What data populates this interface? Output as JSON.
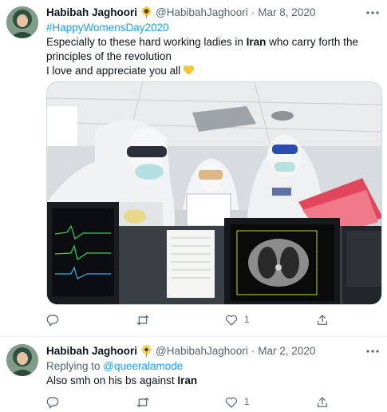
{
  "tweets": [
    {
      "author_name": "Habibah Jaghoori",
      "flag_icon": "sunflower-icon",
      "handle": "@HabibahJaghoori",
      "separator": "·",
      "date": "Mar 8, 2020",
      "hashtag": "#HappyWomensDay2020",
      "body_part1": "Especially to these hard working ladies in ",
      "body_bold": "Iran",
      "body_part2": " who carry forth the principles of the revolution",
      "body_line2": "I love and appreciate you all",
      "emoji_icon": "yellow-heart-icon",
      "actions": {
        "reply_count": "",
        "retweet_count": "",
        "like_count": "1"
      }
    },
    {
      "author_name": "Habibah Jaghoori",
      "flag_icon": "sunflower-icon",
      "handle": "@HabibahJaghoori",
      "separator": "·",
      "date": "Mar 2, 2020",
      "replying_label": "Replying to ",
      "replying_to": "@queeralamode",
      "body_part1": "Also smh on his bs against ",
      "body_bold": "Iran",
      "actions": {
        "reply_count": "",
        "retweet_count": "",
        "like_count": "1"
      }
    }
  ],
  "colors": {
    "link": "#1d9bf0",
    "muted": "#536471",
    "text": "#0f1419"
  }
}
